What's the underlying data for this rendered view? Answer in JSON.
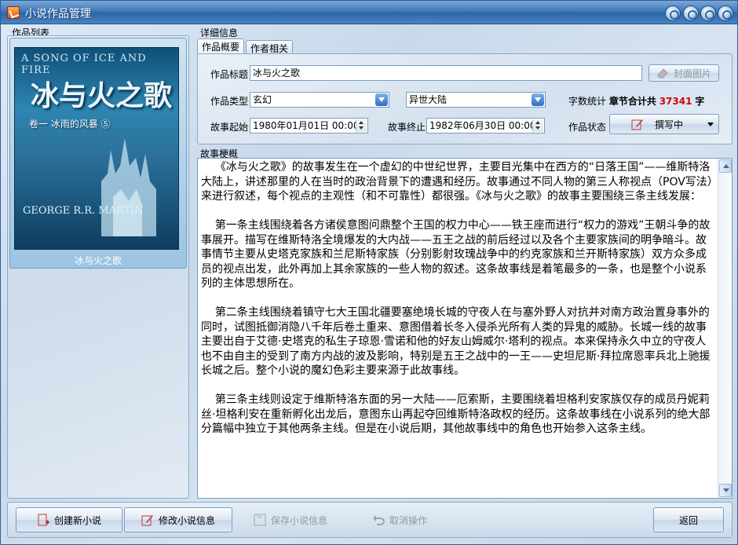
{
  "window": {
    "title": "小说作品管理"
  },
  "works_list": {
    "label": "作品列表",
    "items": [
      {
        "name": "冰与火之歌",
        "cover": {
          "top_text": "A SONG OF ICE AND FIRE",
          "title": "冰与火之歌",
          "subtitle": "卷一 冰雨的风暴 ⑤",
          "author": "GEORGE R.R. MARTIN"
        }
      }
    ]
  },
  "details": {
    "label": "详细信息",
    "tabs": [
      "作品概要",
      "作者相关"
    ],
    "title_label": "作品标题",
    "title_value": "冰与火之歌",
    "cover_button": "封面图片",
    "type_label": "作品类型",
    "type_value": "玄幻",
    "subtype_value": "异世大陆",
    "wordcount_label": "字数统计",
    "wordcount_prefix": "章节合计共",
    "wordcount_value": "37341",
    "wordcount_unit": "字",
    "start_label": "故事起始",
    "start_value": "1980年01月01日 00:00",
    "end_label": "故事终止",
    "end_value": "1982年06月30日 00:00",
    "status_label": "作品状态",
    "status_value": "撰写中"
  },
  "synopsis": {
    "label": "故事梗概",
    "text": "    《冰与火之歌》的故事发生在一个虚幻的中世纪世界，主要目光集中在西方的“日落王国”——维斯特洛大陆上，讲述那里的人在当时的政治背景下的遭遇和经历。故事通过不同人物的第三人称视点（POV写法）来进行叙述，每个视点的主观性（和不可靠性）都很强。《冰与火之歌》的故事主要围绕三条主线发展：\n\n    第一条主线围绕着各方诸侯意图问鼎整个王国的权力中心——铁王座而进行“权力的游戏”王朝斗争的故事展开。描写在维斯特洛全境爆发的大内战——五王之战的前后经过以及各个主要家族间的明争暗斗。故事情节主要从史塔克家族和兰尼斯特家族（分别影射玫瑰战争中的约克家族和兰开斯特家族）双方众多成员的视点出发，此外再加上其余家族的一些人物的叙述。这条故事线是着笔最多的一条，也是整个小说系列的主体思想所在。\n\n    第二条主线围绕着镇守七大王国北疆要塞绝境长城的守夜人在与塞外野人对抗并对南方政治置身事外的同时，试图抵御消隐八千年后卷土重来、意图借着长冬入侵杀光所有人类的异鬼的威胁。长城一线的故事主要出自于艾德·史塔克的私生子琼恩·雪诺和他的好友山姆威尔·塔利的视点。本来保持永久中立的守夜人也不由自主的受到了南方内战的波及影响，特别是五王之战中的一王——史坦尼斯·拜拉席恩率兵北上驰援长城之后。整个小说的魔幻色彩主要来源于此故事线。\n\n    第三条主线则设定于维斯特洛东面的另一大陆——厄索斯，主要围绕着坦格利安家族仅存的成员丹妮莉丝·坦格利安在重新孵化出龙后，意图东山再起夺回维斯特洛政权的经历。这条故事线在小说系列的绝大部分篇幅中独立于其他两条主线。但是在小说后期，其他故事线中的角色也开始参入这条主线。"
  },
  "toolbar": {
    "create": "创建新小说",
    "edit": "修改小说信息",
    "save": "保存小说信息",
    "cancel": "取消操作",
    "back": "返回"
  },
  "colors": {
    "title_bar": "#3f79bb",
    "wordcount_number": "#d40000",
    "selection": "#9cc4e3"
  }
}
